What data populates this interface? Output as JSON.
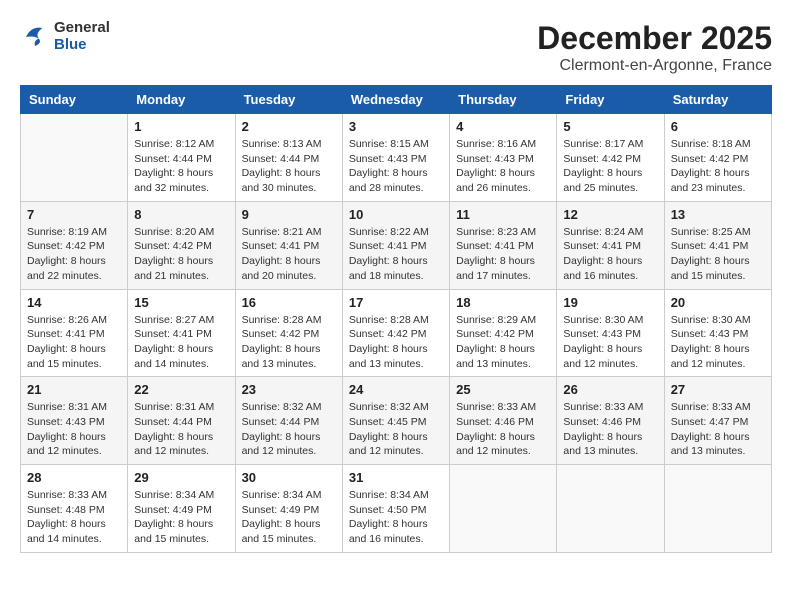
{
  "header": {
    "logo_general": "General",
    "logo_blue": "Blue",
    "title": "December 2025",
    "subtitle": "Clermont-en-Argonne, France"
  },
  "weekdays": [
    "Sunday",
    "Monday",
    "Tuesday",
    "Wednesday",
    "Thursday",
    "Friday",
    "Saturday"
  ],
  "weeks": [
    [
      {
        "day": "",
        "sunrise": "",
        "sunset": "",
        "daylight": ""
      },
      {
        "day": "1",
        "sunrise": "Sunrise: 8:12 AM",
        "sunset": "Sunset: 4:44 PM",
        "daylight": "Daylight: 8 hours and 32 minutes."
      },
      {
        "day": "2",
        "sunrise": "Sunrise: 8:13 AM",
        "sunset": "Sunset: 4:44 PM",
        "daylight": "Daylight: 8 hours and 30 minutes."
      },
      {
        "day": "3",
        "sunrise": "Sunrise: 8:15 AM",
        "sunset": "Sunset: 4:43 PM",
        "daylight": "Daylight: 8 hours and 28 minutes."
      },
      {
        "day": "4",
        "sunrise": "Sunrise: 8:16 AM",
        "sunset": "Sunset: 4:43 PM",
        "daylight": "Daylight: 8 hours and 26 minutes."
      },
      {
        "day": "5",
        "sunrise": "Sunrise: 8:17 AM",
        "sunset": "Sunset: 4:42 PM",
        "daylight": "Daylight: 8 hours and 25 minutes."
      },
      {
        "day": "6",
        "sunrise": "Sunrise: 8:18 AM",
        "sunset": "Sunset: 4:42 PM",
        "daylight": "Daylight: 8 hours and 23 minutes."
      }
    ],
    [
      {
        "day": "7",
        "sunrise": "Sunrise: 8:19 AM",
        "sunset": "Sunset: 4:42 PM",
        "daylight": "Daylight: 8 hours and 22 minutes."
      },
      {
        "day": "8",
        "sunrise": "Sunrise: 8:20 AM",
        "sunset": "Sunset: 4:42 PM",
        "daylight": "Daylight: 8 hours and 21 minutes."
      },
      {
        "day": "9",
        "sunrise": "Sunrise: 8:21 AM",
        "sunset": "Sunset: 4:41 PM",
        "daylight": "Daylight: 8 hours and 20 minutes."
      },
      {
        "day": "10",
        "sunrise": "Sunrise: 8:22 AM",
        "sunset": "Sunset: 4:41 PM",
        "daylight": "Daylight: 8 hours and 18 minutes."
      },
      {
        "day": "11",
        "sunrise": "Sunrise: 8:23 AM",
        "sunset": "Sunset: 4:41 PM",
        "daylight": "Daylight: 8 hours and 17 minutes."
      },
      {
        "day": "12",
        "sunrise": "Sunrise: 8:24 AM",
        "sunset": "Sunset: 4:41 PM",
        "daylight": "Daylight: 8 hours and 16 minutes."
      },
      {
        "day": "13",
        "sunrise": "Sunrise: 8:25 AM",
        "sunset": "Sunset: 4:41 PM",
        "daylight": "Daylight: 8 hours and 15 minutes."
      }
    ],
    [
      {
        "day": "14",
        "sunrise": "Sunrise: 8:26 AM",
        "sunset": "Sunset: 4:41 PM",
        "daylight": "Daylight: 8 hours and 15 minutes."
      },
      {
        "day": "15",
        "sunrise": "Sunrise: 8:27 AM",
        "sunset": "Sunset: 4:41 PM",
        "daylight": "Daylight: 8 hours and 14 minutes."
      },
      {
        "day": "16",
        "sunrise": "Sunrise: 8:28 AM",
        "sunset": "Sunset: 4:42 PM",
        "daylight": "Daylight: 8 hours and 13 minutes."
      },
      {
        "day": "17",
        "sunrise": "Sunrise: 8:28 AM",
        "sunset": "Sunset: 4:42 PM",
        "daylight": "Daylight: 8 hours and 13 minutes."
      },
      {
        "day": "18",
        "sunrise": "Sunrise: 8:29 AM",
        "sunset": "Sunset: 4:42 PM",
        "daylight": "Daylight: 8 hours and 13 minutes."
      },
      {
        "day": "19",
        "sunrise": "Sunrise: 8:30 AM",
        "sunset": "Sunset: 4:43 PM",
        "daylight": "Daylight: 8 hours and 12 minutes."
      },
      {
        "day": "20",
        "sunrise": "Sunrise: 8:30 AM",
        "sunset": "Sunset: 4:43 PM",
        "daylight": "Daylight: 8 hours and 12 minutes."
      }
    ],
    [
      {
        "day": "21",
        "sunrise": "Sunrise: 8:31 AM",
        "sunset": "Sunset: 4:43 PM",
        "daylight": "Daylight: 8 hours and 12 minutes."
      },
      {
        "day": "22",
        "sunrise": "Sunrise: 8:31 AM",
        "sunset": "Sunset: 4:44 PM",
        "daylight": "Daylight: 8 hours and 12 minutes."
      },
      {
        "day": "23",
        "sunrise": "Sunrise: 8:32 AM",
        "sunset": "Sunset: 4:44 PM",
        "daylight": "Daylight: 8 hours and 12 minutes."
      },
      {
        "day": "24",
        "sunrise": "Sunrise: 8:32 AM",
        "sunset": "Sunset: 4:45 PM",
        "daylight": "Daylight: 8 hours and 12 minutes."
      },
      {
        "day": "25",
        "sunrise": "Sunrise: 8:33 AM",
        "sunset": "Sunset: 4:46 PM",
        "daylight": "Daylight: 8 hours and 12 minutes."
      },
      {
        "day": "26",
        "sunrise": "Sunrise: 8:33 AM",
        "sunset": "Sunset: 4:46 PM",
        "daylight": "Daylight: 8 hours and 13 minutes."
      },
      {
        "day": "27",
        "sunrise": "Sunrise: 8:33 AM",
        "sunset": "Sunset: 4:47 PM",
        "daylight": "Daylight: 8 hours and 13 minutes."
      }
    ],
    [
      {
        "day": "28",
        "sunrise": "Sunrise: 8:33 AM",
        "sunset": "Sunset: 4:48 PM",
        "daylight": "Daylight: 8 hours and 14 minutes."
      },
      {
        "day": "29",
        "sunrise": "Sunrise: 8:34 AM",
        "sunset": "Sunset: 4:49 PM",
        "daylight": "Daylight: 8 hours and 15 minutes."
      },
      {
        "day": "30",
        "sunrise": "Sunrise: 8:34 AM",
        "sunset": "Sunset: 4:49 PM",
        "daylight": "Daylight: 8 hours and 15 minutes."
      },
      {
        "day": "31",
        "sunrise": "Sunrise: 8:34 AM",
        "sunset": "Sunset: 4:50 PM",
        "daylight": "Daylight: 8 hours and 16 minutes."
      },
      {
        "day": "",
        "sunrise": "",
        "sunset": "",
        "daylight": ""
      },
      {
        "day": "",
        "sunrise": "",
        "sunset": "",
        "daylight": ""
      },
      {
        "day": "",
        "sunrise": "",
        "sunset": "",
        "daylight": ""
      }
    ]
  ]
}
